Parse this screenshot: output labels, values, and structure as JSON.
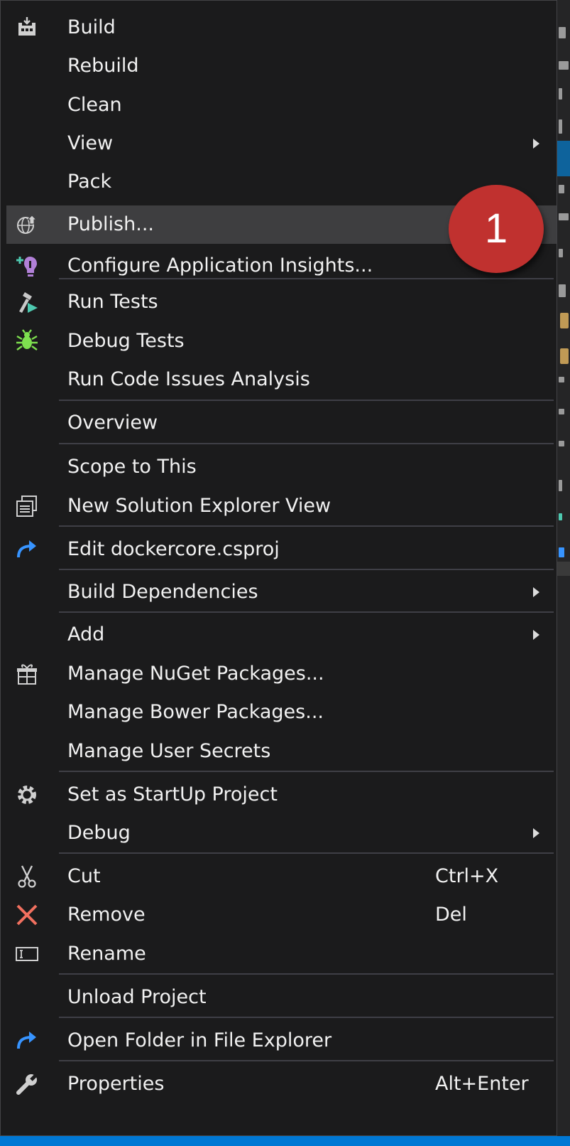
{
  "menu": {
    "items": [
      {
        "label": "Build",
        "icon": "build-icon"
      },
      {
        "label": "Rebuild"
      },
      {
        "label": "Clean"
      },
      {
        "label": "View",
        "submenu": true
      },
      {
        "label": "Pack"
      },
      {
        "label": "Publish...",
        "icon": "publish-globe-icon",
        "highlighted": true
      },
      {
        "label": "Configure Application Insights...",
        "icon": "application-insights-icon"
      },
      {
        "label": "Run Tests",
        "icon": "run-tests-icon"
      },
      {
        "label": "Debug Tests",
        "icon": "debug-tests-bug-icon"
      },
      {
        "label": "Run Code Issues Analysis"
      },
      {
        "label": "Overview"
      },
      {
        "label": "Scope to This"
      },
      {
        "label": "New Solution Explorer View",
        "icon": "new-solution-explorer-view-icon"
      },
      {
        "label": "Edit dockercore.csproj",
        "icon": "edit-project-arrow-icon"
      },
      {
        "label": "Build Dependencies",
        "submenu": true
      },
      {
        "label": "Add",
        "submenu": true
      },
      {
        "label": "Manage NuGet Packages...",
        "icon": "nuget-package-icon"
      },
      {
        "label": "Manage Bower Packages..."
      },
      {
        "label": "Manage User Secrets"
      },
      {
        "label": "Set as StartUp Project",
        "icon": "gear-icon"
      },
      {
        "label": "Debug",
        "submenu": true
      },
      {
        "label": "Cut",
        "icon": "scissors-icon",
        "shortcut": "Ctrl+X"
      },
      {
        "label": "Remove",
        "icon": "close-x-icon",
        "shortcut": "Del"
      },
      {
        "label": "Rename",
        "icon": "rename-icon"
      },
      {
        "label": "Unload Project"
      },
      {
        "label": "Open Folder in File Explorer",
        "icon": "open-folder-arrow-icon"
      },
      {
        "label": "Properties",
        "icon": "wrench-icon",
        "shortcut": "Alt+Enter"
      }
    ]
  },
  "callout": {
    "text": "1",
    "color": "#c0312f"
  },
  "colors": {
    "menu_background": "#1b1b1c",
    "highlight": "#3e3e40",
    "text": "#f1f1f1",
    "separator": "#3f3f46",
    "accent_blue": "#0078d4"
  }
}
